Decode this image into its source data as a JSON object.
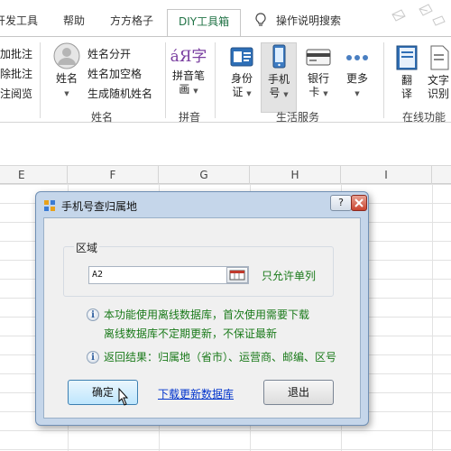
{
  "ribbon": {
    "tabs": [
      {
        "label": "开发工具"
      },
      {
        "label": "帮助"
      },
      {
        "label": "方方格子"
      },
      {
        "label": "DIY工具箱"
      }
    ],
    "search_label": "操作说明搜索",
    "groups": {
      "name_group": {
        "label": "姓名",
        "left_items": [
          "加批注",
          "除批注",
          "注阅览"
        ],
        "name_button": "姓名",
        "items": [
          "姓名分开",
          "姓名加空格",
          "生成随机姓名"
        ]
      },
      "pinyin_group": {
        "label": "拼音",
        "button_line1": "拼音笔",
        "button_line2": "画",
        "button_icon_text": "áЯ字"
      },
      "life_group": {
        "label": "生活服务",
        "buttons": [
          {
            "line1": "身份",
            "line2": "证"
          },
          {
            "line1": "手机",
            "line2": "号"
          },
          {
            "line1": "银行",
            "line2": "卡"
          },
          {
            "line1": "更多",
            "line2": ""
          }
        ]
      },
      "online_group": {
        "label": "在线功能",
        "buttons": [
          {
            "line1": "翻",
            "line2": "译"
          },
          {
            "line1": "文字",
            "line2": "识别"
          }
        ]
      }
    }
  },
  "sheet": {
    "columns": [
      "E",
      "F",
      "G",
      "H",
      "I"
    ]
  },
  "dialog": {
    "title": "手机号查归属地",
    "help_label": "?",
    "group_label": "区域",
    "cell_value": "A2",
    "only_single_column": "只允许单列",
    "info1_line1": "本功能使用离线数据库，首次使用需要下载",
    "info1_line2": "离线数据库不定期更新，不保证最新",
    "info2": "返回结果：归属地（省市）、运营商、邮编、区号",
    "ok_label": "确定",
    "download_link": "下载更新数据库",
    "exit_label": "退出"
  },
  "colors": {
    "accent_green": "#217346",
    "info_green": "#1a7a1a",
    "link_blue": "#0033cc",
    "dialog_frame": "#c5d6ea"
  }
}
